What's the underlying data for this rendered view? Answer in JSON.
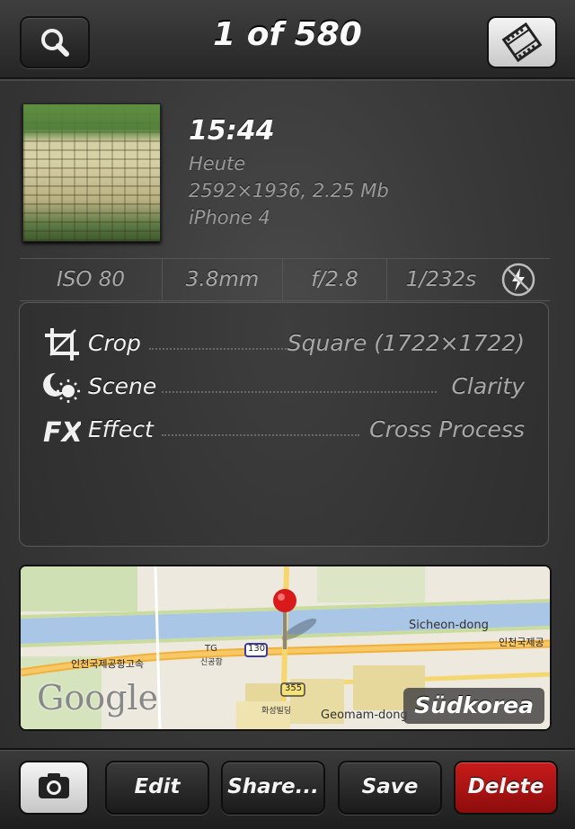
{
  "header": {
    "counter": "1 of 580"
  },
  "photo": {
    "time": "15:44",
    "date": "Heute",
    "dimensions": "2592×1936, 2.25 Mb",
    "device": "iPhone 4"
  },
  "exif": {
    "iso": "ISO 80",
    "focal_length": "3.8mm",
    "aperture": "f/2.8",
    "shutter": "1/232s"
  },
  "edits": [
    {
      "label": "Crop",
      "value": "Square (1722×1722)",
      "icon": "crop-icon"
    },
    {
      "label": "Scene",
      "value": "Clarity",
      "icon": "scene-icon"
    },
    {
      "label": "Effect",
      "value": "Cross Process",
      "icon": "fx-icon"
    }
  ],
  "map": {
    "region": "Südkorea",
    "provider": "Google",
    "place_labels": [
      "Sicheon-dong",
      "인천국제공항고속",
      "인천국제공",
      "TG",
      "신공항",
      "화성빌딩",
      "Geomam-dong"
    ],
    "road_shields": [
      "130",
      "355"
    ]
  },
  "toolbar": {
    "edit_label": "Edit",
    "share_label": "Share...",
    "save_label": "Save",
    "delete_label": "Delete"
  },
  "colors": {
    "delete": "#b31414",
    "background": "#3a3a3a"
  }
}
